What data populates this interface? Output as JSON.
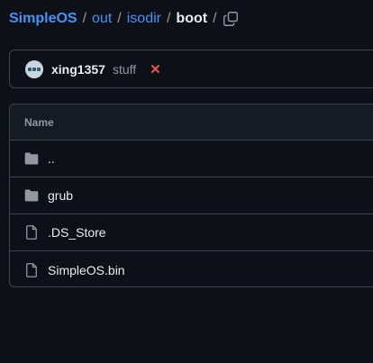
{
  "breadcrumb": {
    "repo": "SimpleOS",
    "segments": [
      "out",
      "isodir"
    ],
    "current": "boot",
    "separator": "/"
  },
  "commit": {
    "author": "xing1357",
    "message": "stuff",
    "status_icon": "x-icon",
    "status_color": "#f85149"
  },
  "table": {
    "header_name": "Name",
    "rows": [
      {
        "name": "..",
        "type": "folder"
      },
      {
        "name": "grub",
        "type": "folder"
      },
      {
        "name": ".DS_Store",
        "type": "file"
      },
      {
        "name": "SimpleOS.bin",
        "type": "file"
      }
    ]
  },
  "colors": {
    "background": "#0d1117",
    "link": "#4493f8",
    "border": "#3d444d",
    "muted": "#9198a1"
  }
}
